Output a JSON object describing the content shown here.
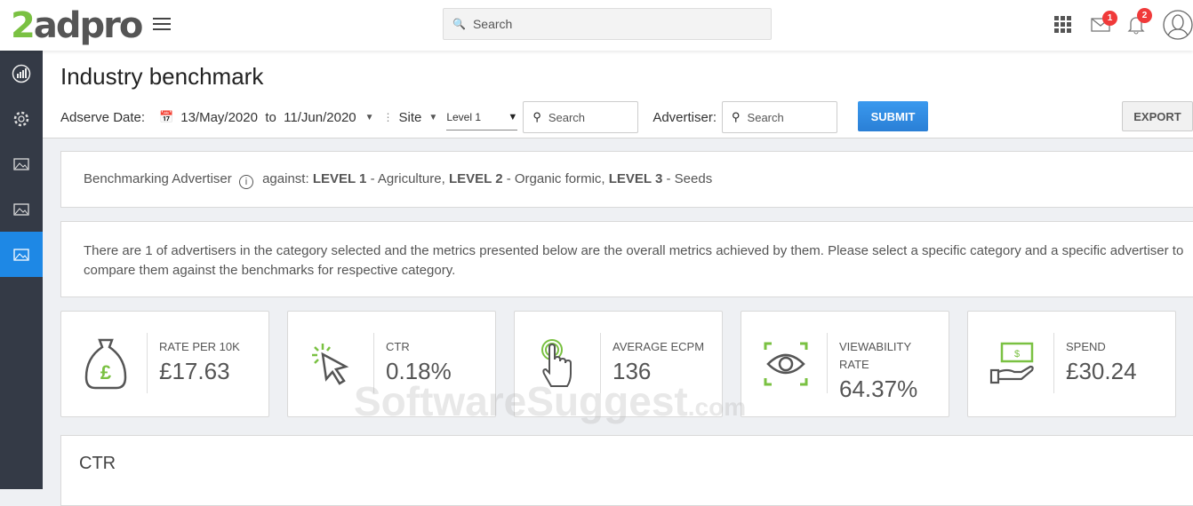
{
  "header": {
    "logo_prefix": "2",
    "logo_rest": "adpro",
    "search_placeholder": "Search",
    "mail_badge": "1",
    "notif_badge": "2"
  },
  "page": {
    "title": "Industry benchmark"
  },
  "filters": {
    "date_label": "Adserve Date:",
    "date_from": "13/May/2020",
    "to": "to",
    "date_to": "11/Jun/2020",
    "site_label": "Site",
    "level_value": "Level 1",
    "search_placeholder": "Search",
    "advertiser_label": "Advertiser:",
    "advertiser_placeholder": "Search",
    "submit": "SUBMIT",
    "export": "EXPORT"
  },
  "benchmark": {
    "prefix": "Benchmarking Advertiser",
    "against": "against:",
    "l1": "LEVEL 1",
    "l1v": " - Agriculture, ",
    "l2": "LEVEL 2",
    "l2v": " - Organic formic, ",
    "l3": "LEVEL 3",
    "l3v": " - Seeds"
  },
  "info": "There are 1 of advertisers in the category selected and the metrics presented below are the overall metrics achieved by them. Please select a specific category and a specific advertiser to compare them against the benchmarks for respective category.",
  "cards": [
    {
      "label": "RATE PER 10K",
      "value": "£17.63",
      "icon": "money-bag-icon"
    },
    {
      "label": "CTR",
      "value": "0.18%",
      "icon": "cursor-click-icon"
    },
    {
      "label": "AVERAGE ECPM",
      "value": "136",
      "icon": "hand-tap-icon"
    },
    {
      "label": "VIEWABILITY RATE",
      "value": "64.37%",
      "icon": "eye-icon"
    },
    {
      "label": "SPEND",
      "value": "£30.24",
      "icon": "cash-hand-icon"
    }
  ],
  "chart_section": {
    "title": "CTR"
  },
  "watermark": {
    "main": "SoftwareSuggest",
    "suffix": ".com"
  },
  "colors": {
    "accent": "#1e88e5",
    "green": "#7ac142",
    "sidebar": "#343a46"
  }
}
